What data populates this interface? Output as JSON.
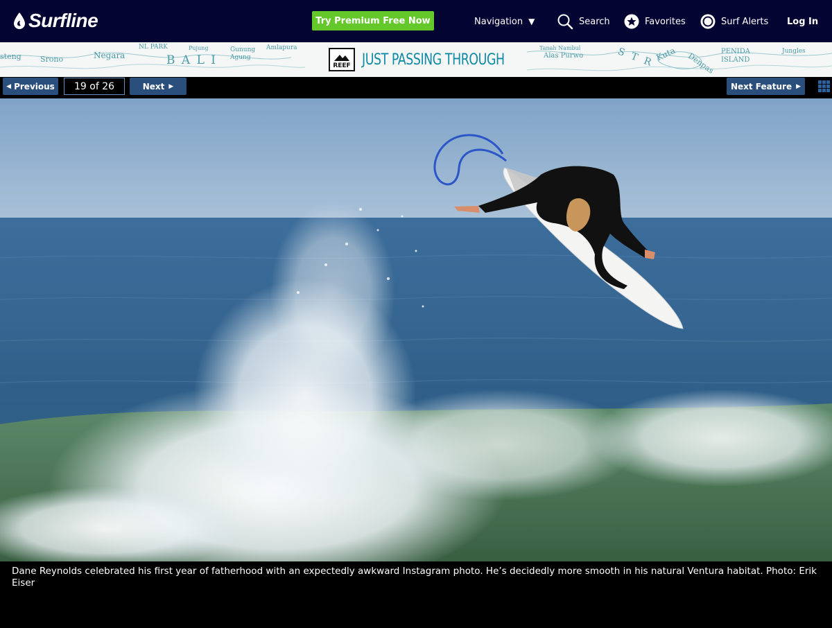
{
  "header": {
    "logo_text": "Surfline",
    "premium_label": "Try Premium Free Now",
    "nav": {
      "navigation": "Navigation",
      "search": "Search",
      "favorites": "Favorites",
      "surf_alerts": "Surf Alerts",
      "login": "Log In"
    },
    "colors": {
      "background": "#040433",
      "premium": "#64c82a"
    }
  },
  "ad": {
    "brand": "REEF",
    "headline": "JUST PASSING THROUGH",
    "map_labels": [
      "steng",
      "Srono",
      "Negara",
      "NL PARK",
      "B A L I",
      "Gunung Agung",
      "Pujung",
      "Amlapura",
      "Tanah Nambul",
      "Alas Purwo",
      "S T R",
      "Kuta",
      "Denpas",
      "PENIDA ISLAND",
      "Jungles"
    ]
  },
  "gallery": {
    "previous_label": "Previous",
    "counter": "19 of 26",
    "next_label": "Next",
    "next_feature_label": "Next Feature",
    "current": 19,
    "total": 26
  },
  "caption": "Dane Reynolds celebrated his first year of fatherhood with an expectedly awkward Instagram photo. He’s decidedly more smooth in his natural Ventura habitat. Photo: Erik Eiser"
}
